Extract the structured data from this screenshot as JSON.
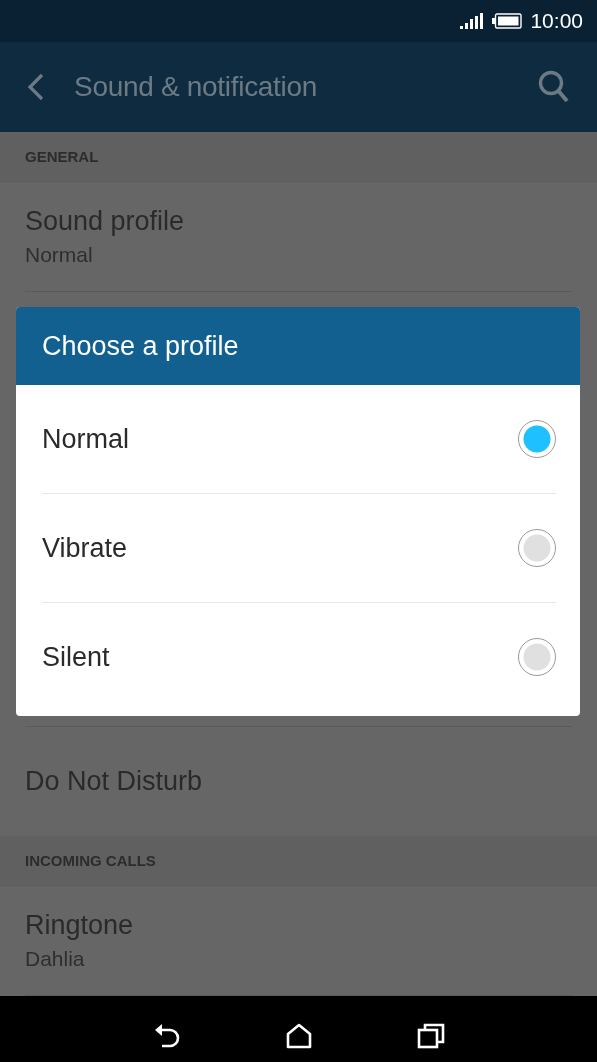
{
  "status_bar": {
    "time": "10:00"
  },
  "app_bar": {
    "title": "Sound & notification"
  },
  "sections": [
    {
      "header": "GENERAL",
      "items": [
        {
          "title": "Sound profile",
          "summary": "Normal"
        }
      ]
    },
    {
      "items": [
        {
          "title": "Do Not Disturb"
        }
      ]
    },
    {
      "header": "INCOMING CALLS",
      "items": [
        {
          "title": "Ringtone",
          "summary": "Dahlia"
        }
      ]
    }
  ],
  "dialog": {
    "title": "Choose a profile",
    "options": [
      {
        "label": "Normal",
        "selected": true
      },
      {
        "label": "Vibrate",
        "selected": false
      },
      {
        "label": "Silent",
        "selected": false
      }
    ]
  }
}
